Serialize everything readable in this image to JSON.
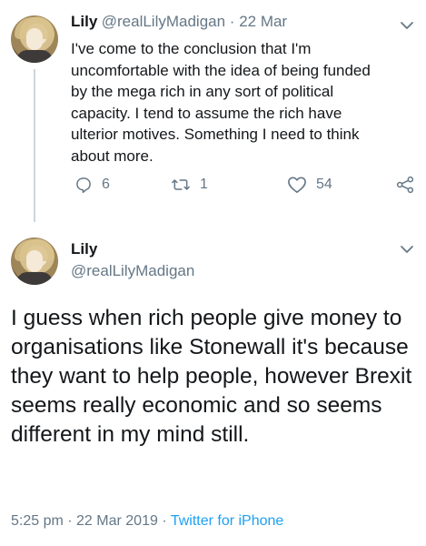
{
  "tweet1": {
    "name": "Lily",
    "handle": "@realLilyMadigan",
    "separator": " · ",
    "date": "22 Mar",
    "text": "I've come to the conclusion that I'm uncomfortable with the idea of being funded by the mega rich in any sort of political capacity. I tend to assume the rich have ulterior motives. Something I need to think about more.",
    "replies": "6",
    "retweets": "1",
    "likes": "54"
  },
  "tweet2": {
    "name": "Lily",
    "handle": "@realLilyMadigan",
    "text": "I guess when rich people give money to organisations like Stonewall it's because they want to help people, however Brexit seems really economic and so seems different in my mind still.",
    "time": "5:25 pm",
    "separator1": " · ",
    "date": "22 Mar 2019",
    "separator2": " · ",
    "source": "Twitter for iPhone"
  },
  "colors": {
    "accent": "#1da1f2",
    "secondary_text": "#657786",
    "primary_text": "#14171a",
    "thread_line": "#ccd6dd"
  },
  "icons": [
    "reply-icon",
    "retweet-icon",
    "like-icon",
    "share-icon",
    "chevron-down-icon"
  ]
}
